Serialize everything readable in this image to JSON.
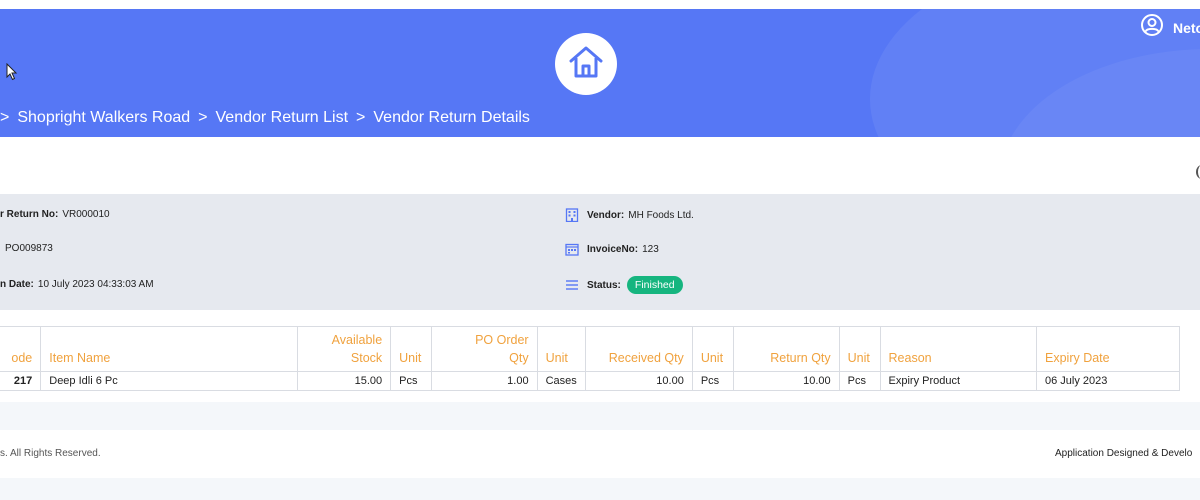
{
  "header": {
    "user_name": "Neto",
    "breadcrumb": [
      {
        "label": "Shopright Walkers Road"
      },
      {
        "label": "Vendor Return List"
      },
      {
        "label": "Vendor Return Details"
      }
    ],
    "accent_color": "#5677f5"
  },
  "details": {
    "return_no_label": "r Return No:",
    "return_no": "VR000010",
    "po_value": "PO009873",
    "date_label": "n Date:",
    "date_value": "10 July 2023 04:33:03 AM",
    "vendor_label": "Vendor:",
    "vendor_value": "MH Foods Ltd.",
    "invoice_label": "InvoiceNo:",
    "invoice_value": "123",
    "status_label": "Status:",
    "status_value": "Finished",
    "status_color": "#16b57f"
  },
  "table": {
    "columns": {
      "code": "ode",
      "item_name": "Item Name",
      "available_stock_1": "Available",
      "available_stock_2": "Stock",
      "unit1": "Unit",
      "po_order_qty_1": "PO Order",
      "po_order_qty_2": "Qty",
      "unit2": "Unit",
      "received_qty": "Received Qty",
      "unit3": "Unit",
      "return_qty": "Return Qty",
      "unit4": "Unit",
      "reason": "Reason",
      "expiry_date": "Expiry Date"
    },
    "rows": [
      {
        "code": "217",
        "item_name": "Deep Idli 6 Pc",
        "available_stock": "15.00",
        "unit1": "Pcs",
        "po_order_qty": "1.00",
        "unit2": "Cases",
        "received_qty": "10.00",
        "unit3": "Pcs",
        "return_qty": "10.00",
        "unit4": "Pcs",
        "reason": "Expiry Product",
        "expiry_date": "06 July 2023"
      }
    ],
    "header_color": "#f0a23e"
  },
  "footer": {
    "left_text": "s. All Rights Reserved.",
    "right_text": "Application Designed & Develo"
  },
  "icons": [
    "home-icon",
    "user-icon",
    "cursor-icon",
    "building-icon",
    "invoice-icon",
    "list-icon"
  ]
}
